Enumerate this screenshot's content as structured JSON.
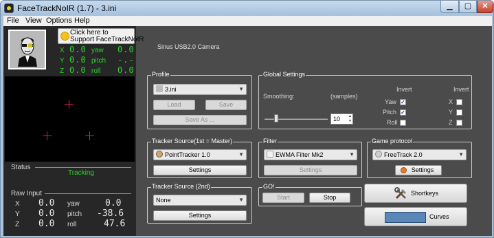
{
  "window": {
    "title": "FaceTrackNoIR (1.7) - 3.ini"
  },
  "caption_buttons": {
    "min": "▁",
    "max": "▢",
    "close": "✕"
  },
  "menu": [
    "File",
    "View",
    "Options",
    "Help"
  ],
  "support": {
    "text": "Click here to\nSupport FaceTrackNoIR"
  },
  "pose_display": {
    "rows": [
      {
        "axis": "X",
        "value": "0.0",
        "rot_label": "yaw",
        "rot_value": "0.0"
      },
      {
        "axis": "Y",
        "value": "0.0",
        "rot_label": "pitch",
        "rot_value": "-.-"
      },
      {
        "axis": "Z",
        "value": "0.0",
        "rot_label": "roll",
        "rot_value": "0.0"
      }
    ]
  },
  "status": {
    "label": "Status",
    "value": "Tracking"
  },
  "raw_input": {
    "label": "Raw Input",
    "rows": [
      {
        "axis": "X",
        "value": "0.0",
        "rot_label": "yaw",
        "rot_value": "0.0"
      },
      {
        "axis": "Y",
        "value": "0.0",
        "rot_label": "pitch",
        "rot_value": "-38.6"
      },
      {
        "axis": "Z",
        "value": "0.0",
        "rot_label": "roll",
        "rot_value": "47.6"
      }
    ]
  },
  "camera": {
    "name": "Sinus USB2.0 Camera"
  },
  "profile": {
    "title": "Profile",
    "value": "3.ini",
    "load": "Load",
    "save": "Save",
    "save_as": "Save As ..."
  },
  "global_settings": {
    "title": "Global Settings",
    "smoothing_label": "Smoothing:",
    "samples_label": "(samples)",
    "samples_value": "10",
    "slider_fraction": 0.18,
    "invert_label": "Invert",
    "invert_rot": [
      {
        "label": "Yaw",
        "checked": true
      },
      {
        "label": "Pitch",
        "checked": true
      },
      {
        "label": "Roll",
        "checked": false
      }
    ],
    "invert_pos": [
      {
        "label": "X",
        "checked": false
      },
      {
        "label": "Y",
        "checked": false
      },
      {
        "label": "Z",
        "checked": false
      }
    ]
  },
  "tracker_source": {
    "title": "Tracker Source(1st = Master)",
    "value": "PointTracker 1.0",
    "settings": "Settings"
  },
  "filter": {
    "title": "Filter",
    "value": "EWMA Filter Mk2",
    "settings": "Settings"
  },
  "game_protocol": {
    "title": "Game protocol",
    "value": "FreeTrack 2.0",
    "settings": "Settings"
  },
  "tracker_source_2nd": {
    "title": "Tracker Source (2nd)",
    "value": "None",
    "settings": "Settings"
  },
  "go": {
    "title": "GO!",
    "start": "Start",
    "stop": "Stop"
  },
  "shortkeys": {
    "label": "Shortkeys"
  },
  "curves": {
    "label": "Curves"
  },
  "colors": {
    "green": "#2ad12a",
    "crosshair": "#d11e6a",
    "panel": "#4b4b4b",
    "dark": "#272727"
  }
}
